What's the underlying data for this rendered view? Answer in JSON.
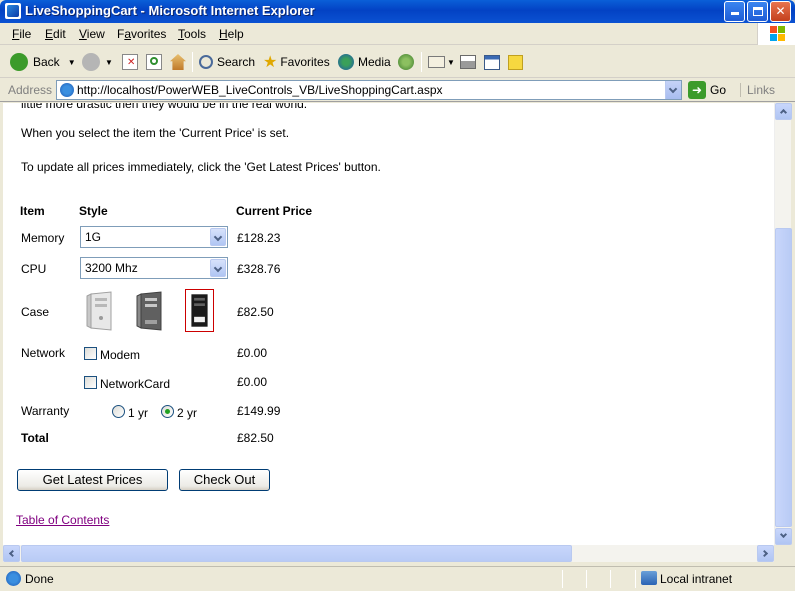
{
  "window": {
    "title": "LiveShoppingCart - Microsoft Internet Explorer",
    "controls": [
      "minimize",
      "maximize",
      "close"
    ]
  },
  "menu": {
    "items": [
      {
        "label": "File",
        "accel": "F",
        "rest": "ile"
      },
      {
        "label": "Edit",
        "accel": "E",
        "rest": "dit"
      },
      {
        "label": "View",
        "accel": "V",
        "rest": "iew"
      },
      {
        "label": "Favorites",
        "accel": "a",
        "pre": "F",
        "rest": "vorites"
      },
      {
        "label": "Tools",
        "accel": "T",
        "rest": "ools"
      },
      {
        "label": "Help",
        "accel": "H",
        "rest": "elp"
      }
    ]
  },
  "toolbar": {
    "back_label": "Back",
    "search_label": "Search",
    "favorites_label": "Favorites",
    "media_label": "Media"
  },
  "address": {
    "label": "Address",
    "url": "http://localhost/PowerWEB_LiveControls_VB/LiveShoppingCart.aspx",
    "go_label": "Go",
    "links_label": "Links"
  },
  "page": {
    "intro_cut": "little more drastic then they would be in the real world.",
    "intro2": "When you select the item the 'Current Price' is set.",
    "intro3": "To update all prices immediately, click the 'Get Latest Prices' button.",
    "headers": {
      "item": "Item",
      "style": "Style",
      "price": "Current Price"
    },
    "rows": {
      "memory": {
        "label": "Memory",
        "selected": "1G",
        "price": "£128.23"
      },
      "cpu": {
        "label": "CPU",
        "selected": "3200 Mhz",
        "price": "£328.76"
      },
      "case": {
        "label": "Case",
        "price": "£82.50"
      },
      "network": {
        "label": "Network",
        "modem": "Modem",
        "modem_price": "£0.00",
        "card": "NetworkCard",
        "card_price": "£0.00"
      },
      "warranty": {
        "label": "Warranty",
        "opt1": "1 yr",
        "opt2": "2 yr",
        "price": "£149.99"
      },
      "total": {
        "label": "Total",
        "price": "£82.50"
      }
    },
    "buttons": {
      "latest": "Get Latest Prices",
      "checkout": "Check Out"
    },
    "toc_link": "Table of Contents"
  },
  "status": {
    "text": "Done",
    "zone": "Local intranet"
  },
  "colors": {
    "titlebar": "#0342c4",
    "link_visited": "#800080",
    "selected_case_border": "#cc0000",
    "radio_dot": "#21a121"
  }
}
